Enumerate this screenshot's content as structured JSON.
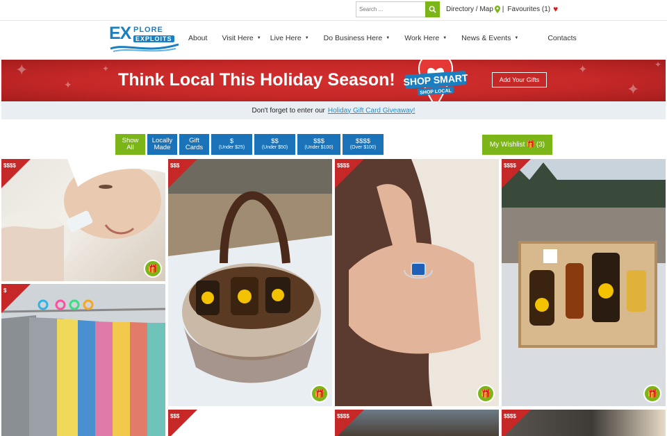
{
  "topbar": {
    "search_placeholder": "Search ...",
    "directory_label": "Directory / Map",
    "favourites_label": "Favourites (1)"
  },
  "logo": {
    "part1": "EX",
    "part2": "PLORE",
    "part3": "EXPLOITS"
  },
  "nav": {
    "items": [
      {
        "label": "About",
        "dropdown": false
      },
      {
        "label": "Visit Here",
        "dropdown": true
      },
      {
        "label": "Live Here",
        "dropdown": true
      },
      {
        "label": "Do Business Here",
        "dropdown": true
      },
      {
        "label": "Work Here",
        "dropdown": true
      },
      {
        "label": "News & Events",
        "dropdown": true
      },
      {
        "label": "Contacts",
        "dropdown": false
      }
    ]
  },
  "banner": {
    "title": "Think Local This Holiday Season!",
    "badge_line1": "SHOP SMART",
    "badge_line2": "SHOP LOCAL",
    "add_gifts_label": "Add Your Gifts"
  },
  "subbanner": {
    "text": "Don't forget to enter our",
    "link": "Holiday Gift Card Giveaway!"
  },
  "filters": [
    {
      "line1": "Show",
      "line2": "All",
      "active": true
    },
    {
      "line1": "Locally",
      "line2": "Made",
      "active": false
    },
    {
      "line1": "Gift",
      "line2": "Cards",
      "active": false
    },
    {
      "line1": "$",
      "line2": "(Under $25)",
      "active": false
    },
    {
      "line1": "$$",
      "line2": "(Under $50)",
      "active": false
    },
    {
      "line1": "$$$",
      "line2": "(Under $100)",
      "active": false
    },
    {
      "line1": "$$$$",
      "line2": "(Over $100)",
      "active": false
    }
  ],
  "wishlist": {
    "label": "My Wishlist",
    "count": "(3)"
  },
  "tiles": [
    {
      "price": "$$$$",
      "subject": "facial-treatment"
    },
    {
      "price": "$",
      "subject": "clothing-rack"
    },
    {
      "price": "$$$",
      "subject": "honey-gift-basket"
    },
    {
      "price": "$$$$",
      "subject": "sapphire-ring"
    },
    {
      "price": "$$$$",
      "subject": "honey-gift-box"
    },
    {
      "price": "$$$",
      "subject": "product-photo"
    },
    {
      "price": "$$$$",
      "subject": "product-photo"
    },
    {
      "price": "$$$$",
      "subject": "product-photo"
    }
  ],
  "colors": {
    "accent_green": "#7cb518",
    "brand_blue": "#1a73b8",
    "banner_red": "#c62828"
  }
}
